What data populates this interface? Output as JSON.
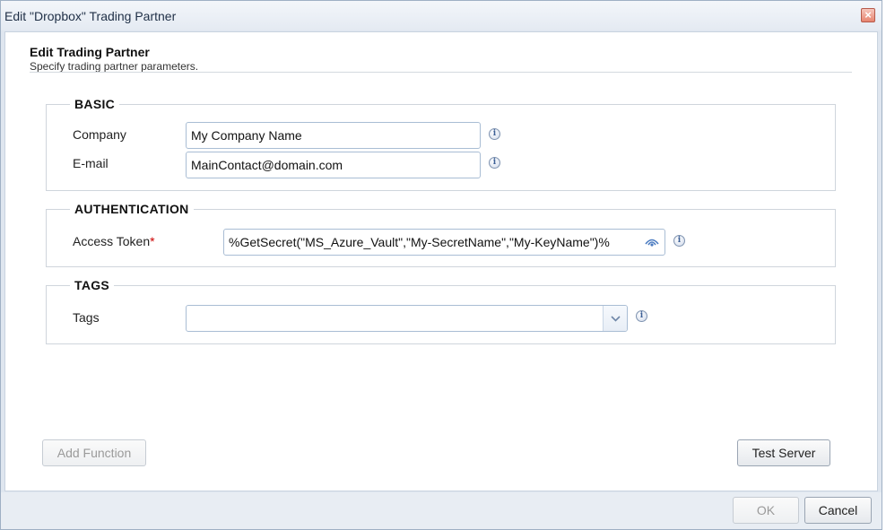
{
  "window": {
    "title": "Edit \"Dropbox\" Trading Partner",
    "close_label": "×"
  },
  "header": {
    "title": "Edit Trading Partner",
    "subtitle": "Specify trading partner parameters."
  },
  "basic": {
    "legend": "BASIC",
    "company_label": "Company",
    "company_value": "My Company Name",
    "email_label": "E-mail",
    "email_value": "MainContact@domain.com"
  },
  "authentication": {
    "legend": "AUTHENTICATION",
    "token_label": "Access Token",
    "required_mark": "*",
    "token_value": "%GetSecret(\"MS_Azure_Vault\",\"My-SecretName\",\"My-KeyName\")%"
  },
  "tags": {
    "legend": "TAGS",
    "tags_label": "Tags",
    "tags_value": ""
  },
  "info_glyph": "i",
  "actions": {
    "add_function": "Add Function",
    "test_server": "Test Server",
    "ok": "OK",
    "cancel": "Cancel"
  }
}
